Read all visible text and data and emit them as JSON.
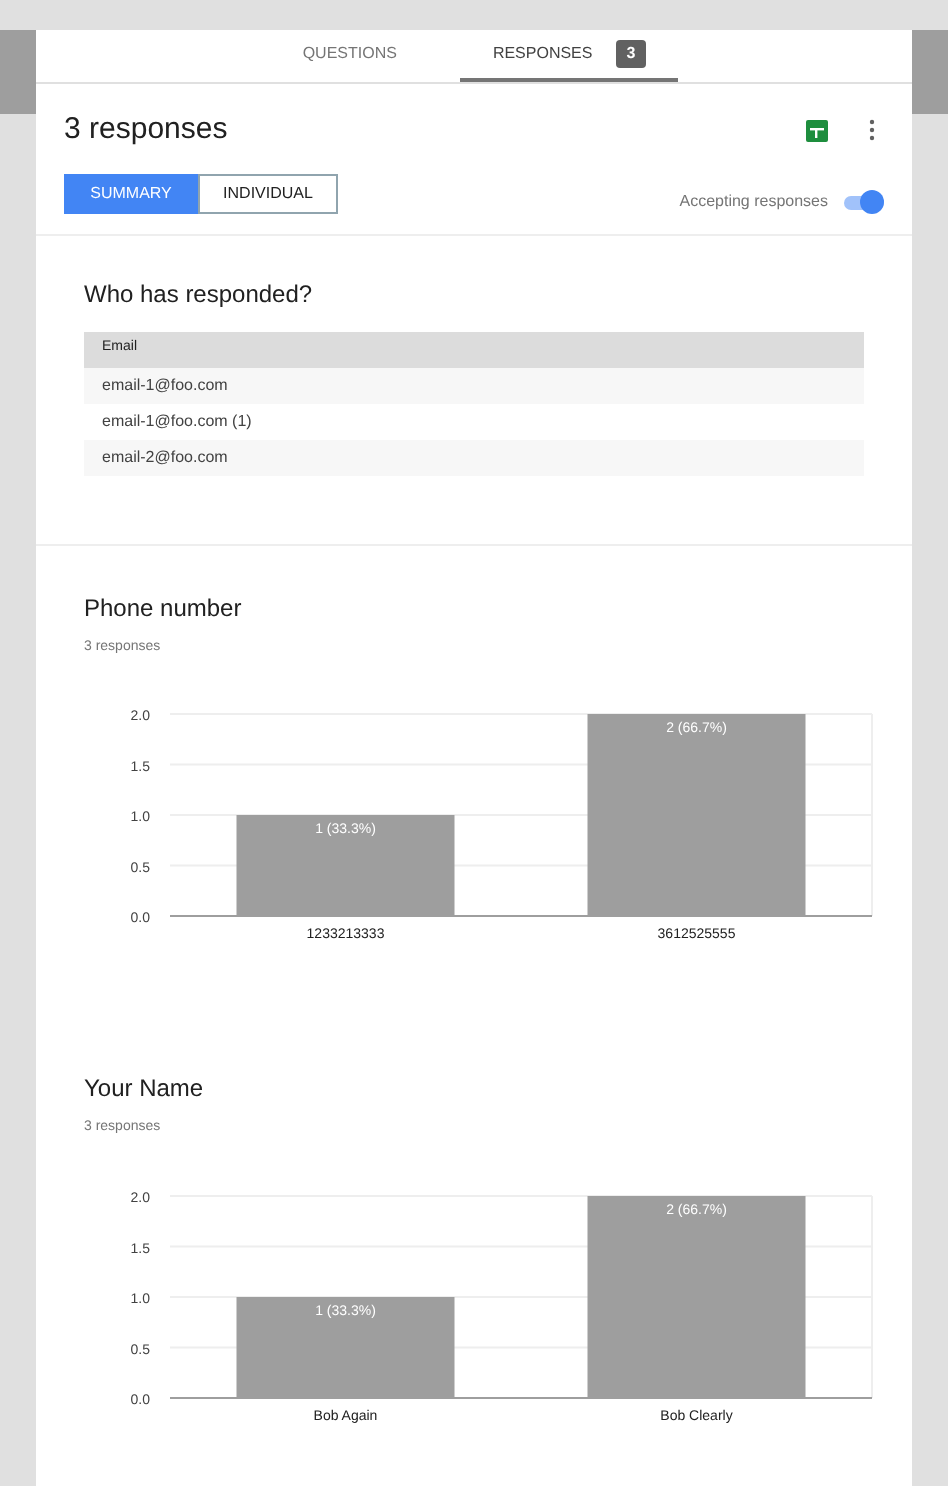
{
  "tabs": [
    {
      "label": "QUESTIONS",
      "selected": false
    },
    {
      "label": "RESPONSES",
      "selected": true,
      "badge": "3"
    }
  ],
  "header": {
    "title": "3 responses",
    "views": [
      {
        "label": "SUMMARY",
        "selected": true
      },
      {
        "label": "INDIVIDUAL",
        "selected": false
      }
    ],
    "accepting": {
      "label": "Accepting responses",
      "on": true
    }
  },
  "respondents": {
    "title": "Who has responded?",
    "column": "Email",
    "rows": [
      "email-1@foo.com",
      "email-1@foo.com (1)",
      "email-2@foo.com"
    ]
  },
  "questions": [
    {
      "title": "Phone number",
      "count": "3 responses",
      "chart_data": {
        "type": "bar",
        "categories": [
          "1233213333",
          "3612525555"
        ],
        "values": [
          1,
          2
        ],
        "ylim": [
          0,
          2
        ],
        "yticks": [
          {
            "value": 0,
            "label": "0.0"
          },
          {
            "value": 0.5,
            "label": "0.5"
          },
          {
            "value": 1,
            "label": "1.0"
          },
          {
            "value": 1.5,
            "label": "1.5"
          },
          {
            "value": 2,
            "label": "2.0"
          }
        ],
        "grid": true,
        "value_labels": [
          "1 (33.3%)",
          "2 (66.7%)"
        ]
      }
    },
    {
      "title": "Your Name",
      "count": "3 responses",
      "chart_data": {
        "type": "bar",
        "categories": [
          "Bob Again",
          "Bob Clearly"
        ],
        "values": [
          1,
          2
        ],
        "ylim": [
          0,
          2
        ],
        "yticks": [
          {
            "value": 0,
            "label": "0.0"
          },
          {
            "value": 0.5,
            "label": "0.5"
          },
          {
            "value": 1,
            "label": "1.0"
          },
          {
            "value": 1.5,
            "label": "1.5"
          },
          {
            "value": 2,
            "label": "2.0"
          }
        ],
        "grid": true,
        "value_labels": [
          "1 (33.3%)",
          "2 (66.7%)"
        ]
      }
    }
  ]
}
